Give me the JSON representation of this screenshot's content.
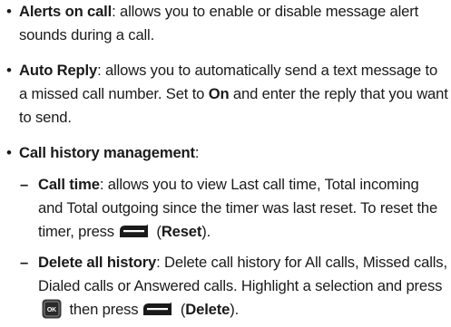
{
  "bullet_glyph": "•",
  "dash_glyph": "–",
  "items": {
    "alerts": {
      "term": "Alerts on call",
      "desc": ": allows you to enable or disable message alert sounds during a call."
    },
    "auto_reply": {
      "term": "Auto Reply",
      "desc_a": ": allows you to automatically send a text message to a missed call number. Set to ",
      "on": "On",
      "desc_b": " and enter the reply that you want to send."
    },
    "history": {
      "term": "Call history management",
      "colon": ":"
    },
    "call_time": {
      "term": "Call time",
      "desc": ": allows you to view Last call time, Total incoming and Total outgoing since the timer was last reset. To reset the timer, press",
      "paren_open": " (",
      "key_label": "Reset",
      "paren_close": ")."
    },
    "delete_all": {
      "term": "Delete all history",
      "desc": ": Delete call history for All calls, Missed calls, Dialed calls or Answered calls. Highlight a selection and press",
      "ok_key_text": "OK",
      "then_press": " then press",
      "paren_open": " (",
      "key_label": "Delete",
      "paren_close": ")."
    }
  },
  "icons": {
    "softkey": "left-softkey-icon",
    "ok": "ok-key-icon"
  }
}
